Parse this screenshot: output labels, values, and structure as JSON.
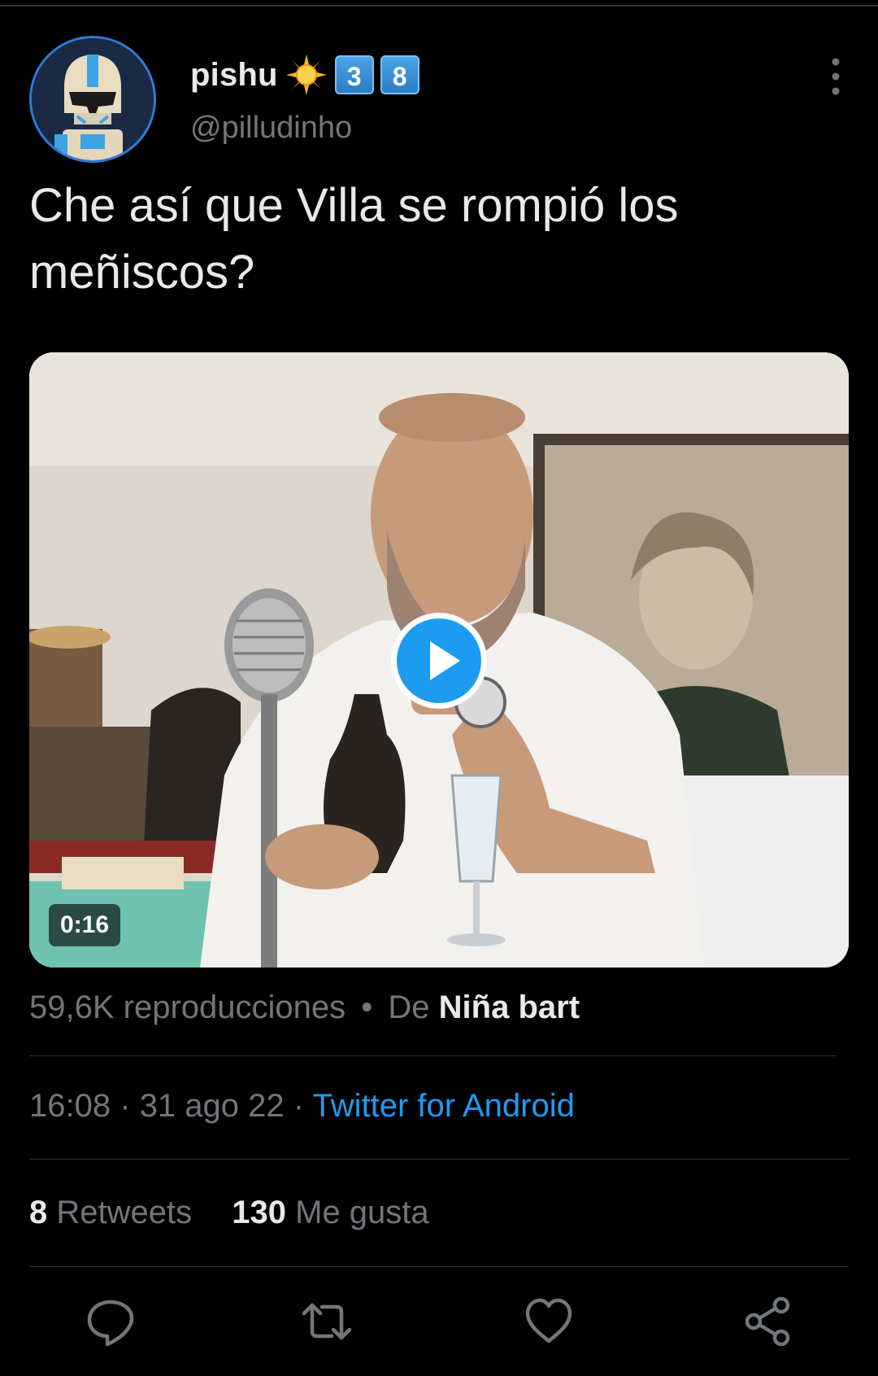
{
  "author": {
    "display_name": "pishu",
    "badge_digits": [
      "3",
      "8"
    ],
    "handle": "@pilludinho"
  },
  "tweet": {
    "text": "Che así que Villa se rompió los meñiscos?"
  },
  "media": {
    "duration": "0:16"
  },
  "views": {
    "count_text": "59,6K reproducciones",
    "separator": "•",
    "by_prefix": "De",
    "by_name": "Niña bart"
  },
  "meta": {
    "time": "16:08",
    "separator": "·",
    "date": "31 ago 22",
    "source": "Twitter for Android"
  },
  "stats": {
    "retweets_count": "8",
    "retweets_label": "Retweets",
    "likes_count": "130",
    "likes_label": "Me gusta"
  },
  "icons": {
    "more": "more-vertical-icon",
    "reply": "reply-icon",
    "retweet": "retweet-icon",
    "like": "heart-icon",
    "share": "share-icon",
    "play": "play-icon"
  },
  "colors": {
    "background": "#000000",
    "text_primary": "#e7e9ea",
    "text_secondary": "#71767b",
    "accent": "#1d9bf0",
    "divider": "#2f3336"
  }
}
